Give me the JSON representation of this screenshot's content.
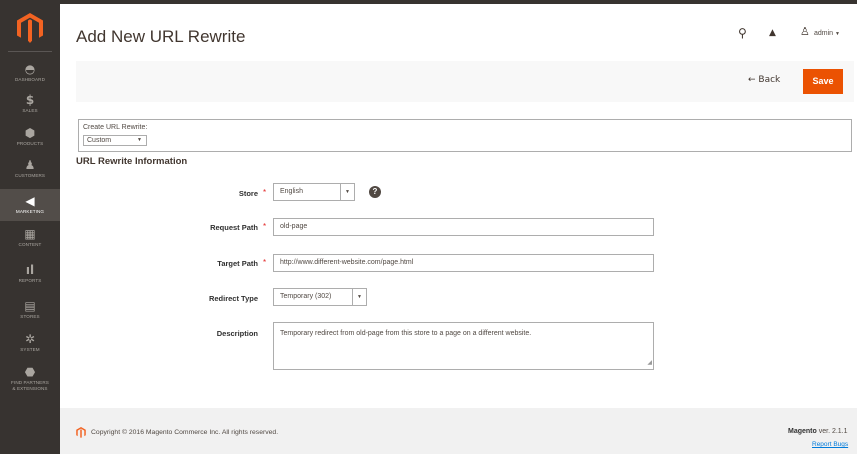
{
  "header": {
    "title": "Add New URL Rewrite",
    "admin_label": "admin"
  },
  "sidebar": {
    "items": [
      {
        "label": "Dashboard",
        "icon": "dashboard-icon",
        "glyph": "◓"
      },
      {
        "label": "Sales",
        "icon": "dollar-icon",
        "glyph": "$"
      },
      {
        "label": "Products",
        "icon": "cube-icon",
        "glyph": "⬢"
      },
      {
        "label": "Customers",
        "icon": "person-icon",
        "glyph": "♟"
      },
      {
        "label": "Marketing",
        "icon": "megaphone-icon",
        "glyph": "◀"
      },
      {
        "label": "Content",
        "icon": "content-icon",
        "glyph": "▦"
      },
      {
        "label": "Reports",
        "icon": "bar-chart-icon",
        "glyph": "ıl"
      },
      {
        "label": "Stores",
        "icon": "store-icon",
        "glyph": "▤"
      },
      {
        "label": "System",
        "icon": "gear-icon",
        "glyph": "✲"
      },
      {
        "label": "Find Partners",
        "label2": "& Extensions",
        "icon": "partners-icon",
        "glyph": "⬣"
      }
    ]
  },
  "actions": {
    "back_label": "← Back",
    "save_label": "Save"
  },
  "create": {
    "label": "Create URL Rewrite:",
    "value": "Custom"
  },
  "section": {
    "title": "URL Rewrite Information"
  },
  "form": {
    "store_label": "Store",
    "store_value": "English",
    "request_path_label": "Request Path",
    "request_path_value": "old-page",
    "target_path_label": "Target Path",
    "target_path_value": "http://www.different-website.com/page.html",
    "redirect_type_label": "Redirect Type",
    "redirect_type_value": "Temporary (302)",
    "description_label": "Description",
    "description_value": "Temporary redirect from old-page from this store to a page on a different website.",
    "required_mark": "*",
    "help_glyph": "?"
  },
  "footer": {
    "copyright": "Copyright © 2016 Magento Commerce Inc. All rights reserved.",
    "brand": "Magento",
    "version": " ver. 2.1.1",
    "report": "Report Bugs"
  },
  "colors": {
    "sidebar_bg": "#373330",
    "accent": "#eb5202",
    "link": "#007bdb",
    "required": "#e22626"
  }
}
